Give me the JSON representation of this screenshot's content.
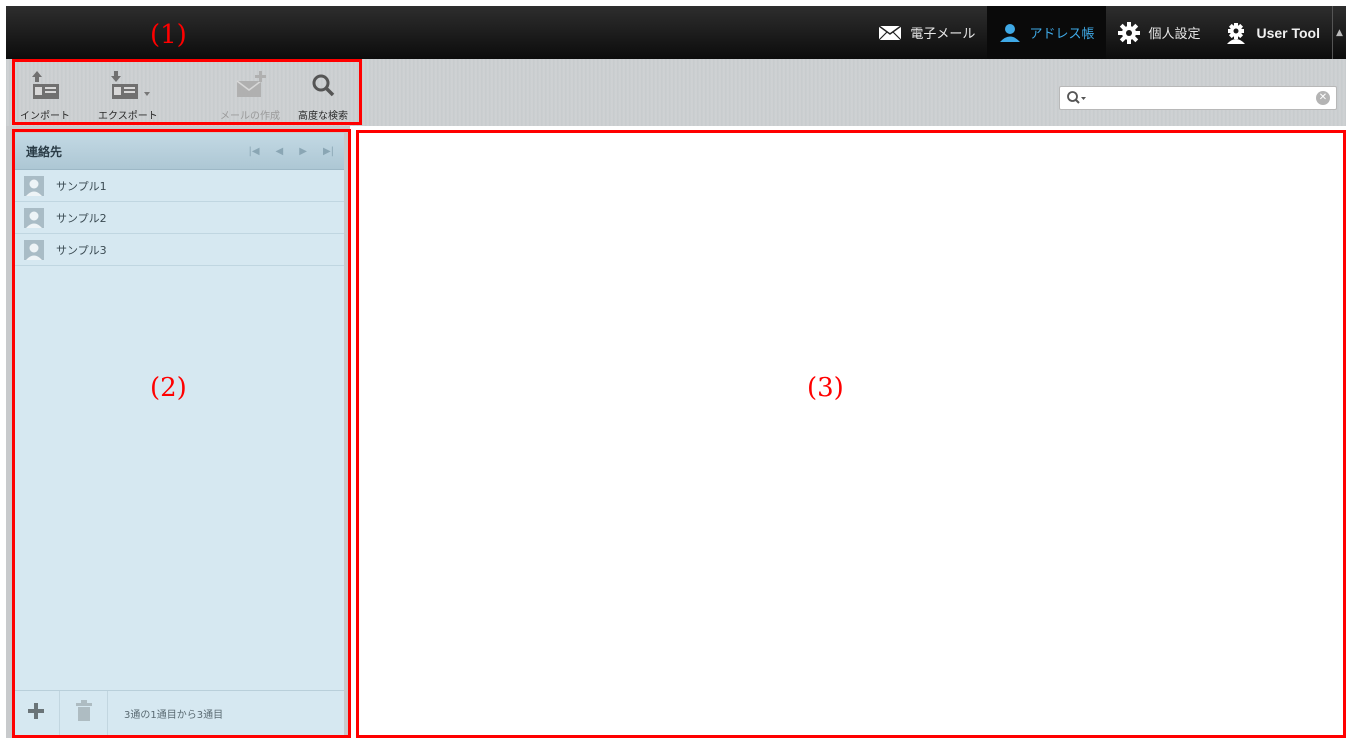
{
  "nav": {
    "items": [
      {
        "label": "電子メール",
        "icon": "envelope-icon"
      },
      {
        "label": "アドレス帳",
        "icon": "person-icon",
        "active": true
      },
      {
        "label": "個人設定",
        "icon": "gear-icon"
      },
      {
        "label": "User Tool",
        "icon": "user-gear-icon"
      }
    ]
  },
  "toolbar": {
    "import_label": "インポート",
    "export_label": "エクスポート",
    "compose_label": "メールの作成",
    "advanced_search_label": "高度な検索"
  },
  "search": {
    "value": "",
    "placeholder": ""
  },
  "contacts": {
    "title": "連絡先",
    "items": [
      {
        "name": "サンプル1"
      },
      {
        "name": "サンプル2"
      },
      {
        "name": "サンプル3"
      }
    ],
    "status": "3通の1通目から3通目"
  },
  "annotations": {
    "label1": "(1)",
    "label2": "(2)",
    "label3": "(3)",
    "color": "#ff0000"
  },
  "colors": {
    "accent": "#3fa9e6",
    "panel": "#d6e8f1"
  }
}
